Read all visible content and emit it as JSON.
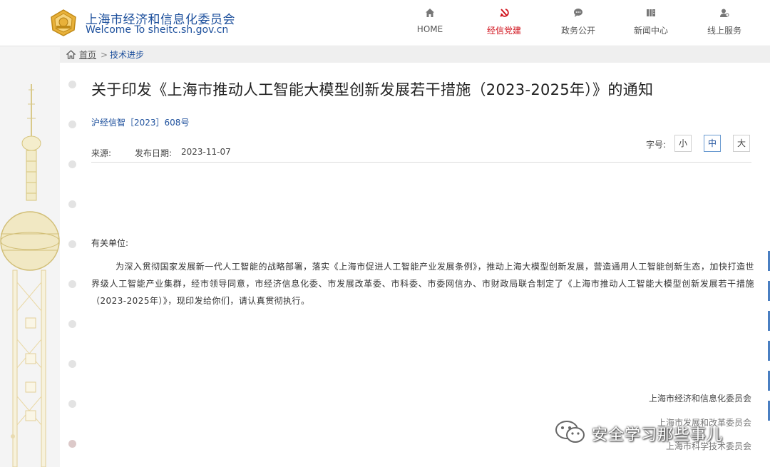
{
  "header": {
    "site_name_cn": "上海市经济和信息化委员会",
    "site_name_en": "Welcome  To  sheitc.sh.gov.cn",
    "nav": [
      {
        "label": "HOME",
        "icon": "home-icon",
        "active": false
      },
      {
        "label": "经信党建",
        "icon": "hammer-sickle-icon",
        "active": true
      },
      {
        "label": "政务公开",
        "icon": "chat-icon",
        "active": false
      },
      {
        "label": "新闻中心",
        "icon": "newspaper-icon",
        "active": false
      },
      {
        "label": "线上服务",
        "icon": "user-service-icon",
        "active": false
      }
    ],
    "accent_color": "#d0111b",
    "brand_color": "#1c4f9c"
  },
  "breadcrumb": {
    "home": "首页",
    "separator": ">",
    "current": "技术进步"
  },
  "article": {
    "title": "关于印发《上海市推动人工智能大模型创新发展若干措施（2023-2025年）》的通知",
    "doc_number": "沪经信智［2023］608号",
    "source_label": "来源:",
    "date_label": "发布日期:",
    "date": "2023-11-07",
    "font_size": {
      "label": "字号:",
      "small": "小",
      "medium": "中",
      "large": "大",
      "selected": "中"
    },
    "salutation": "有关单位:",
    "body": "为深入贯彻国家发展新一代人工智能的战略部署，落实《上海市促进人工智能产业发展条例》，推动上海大模型创新发展，营造通用人工智能创新生态，加快打造世界级人工智能产业集群，经市领导同意，市经济信息化委、市发展改革委、市科委、市委网信办、市财政局联合制定了《上海市推动人工智能大模型创新发展若干措施（2023-2025年）》，现印发给你们，请认真贯彻执行。",
    "signers": [
      "上海市经济和信息化委员会",
      "上海市发展和改革委员会",
      "上海市科学技术委员会"
    ]
  },
  "watermark": {
    "text": "安全学习那些事儿",
    "icon": "wechat-icon"
  }
}
